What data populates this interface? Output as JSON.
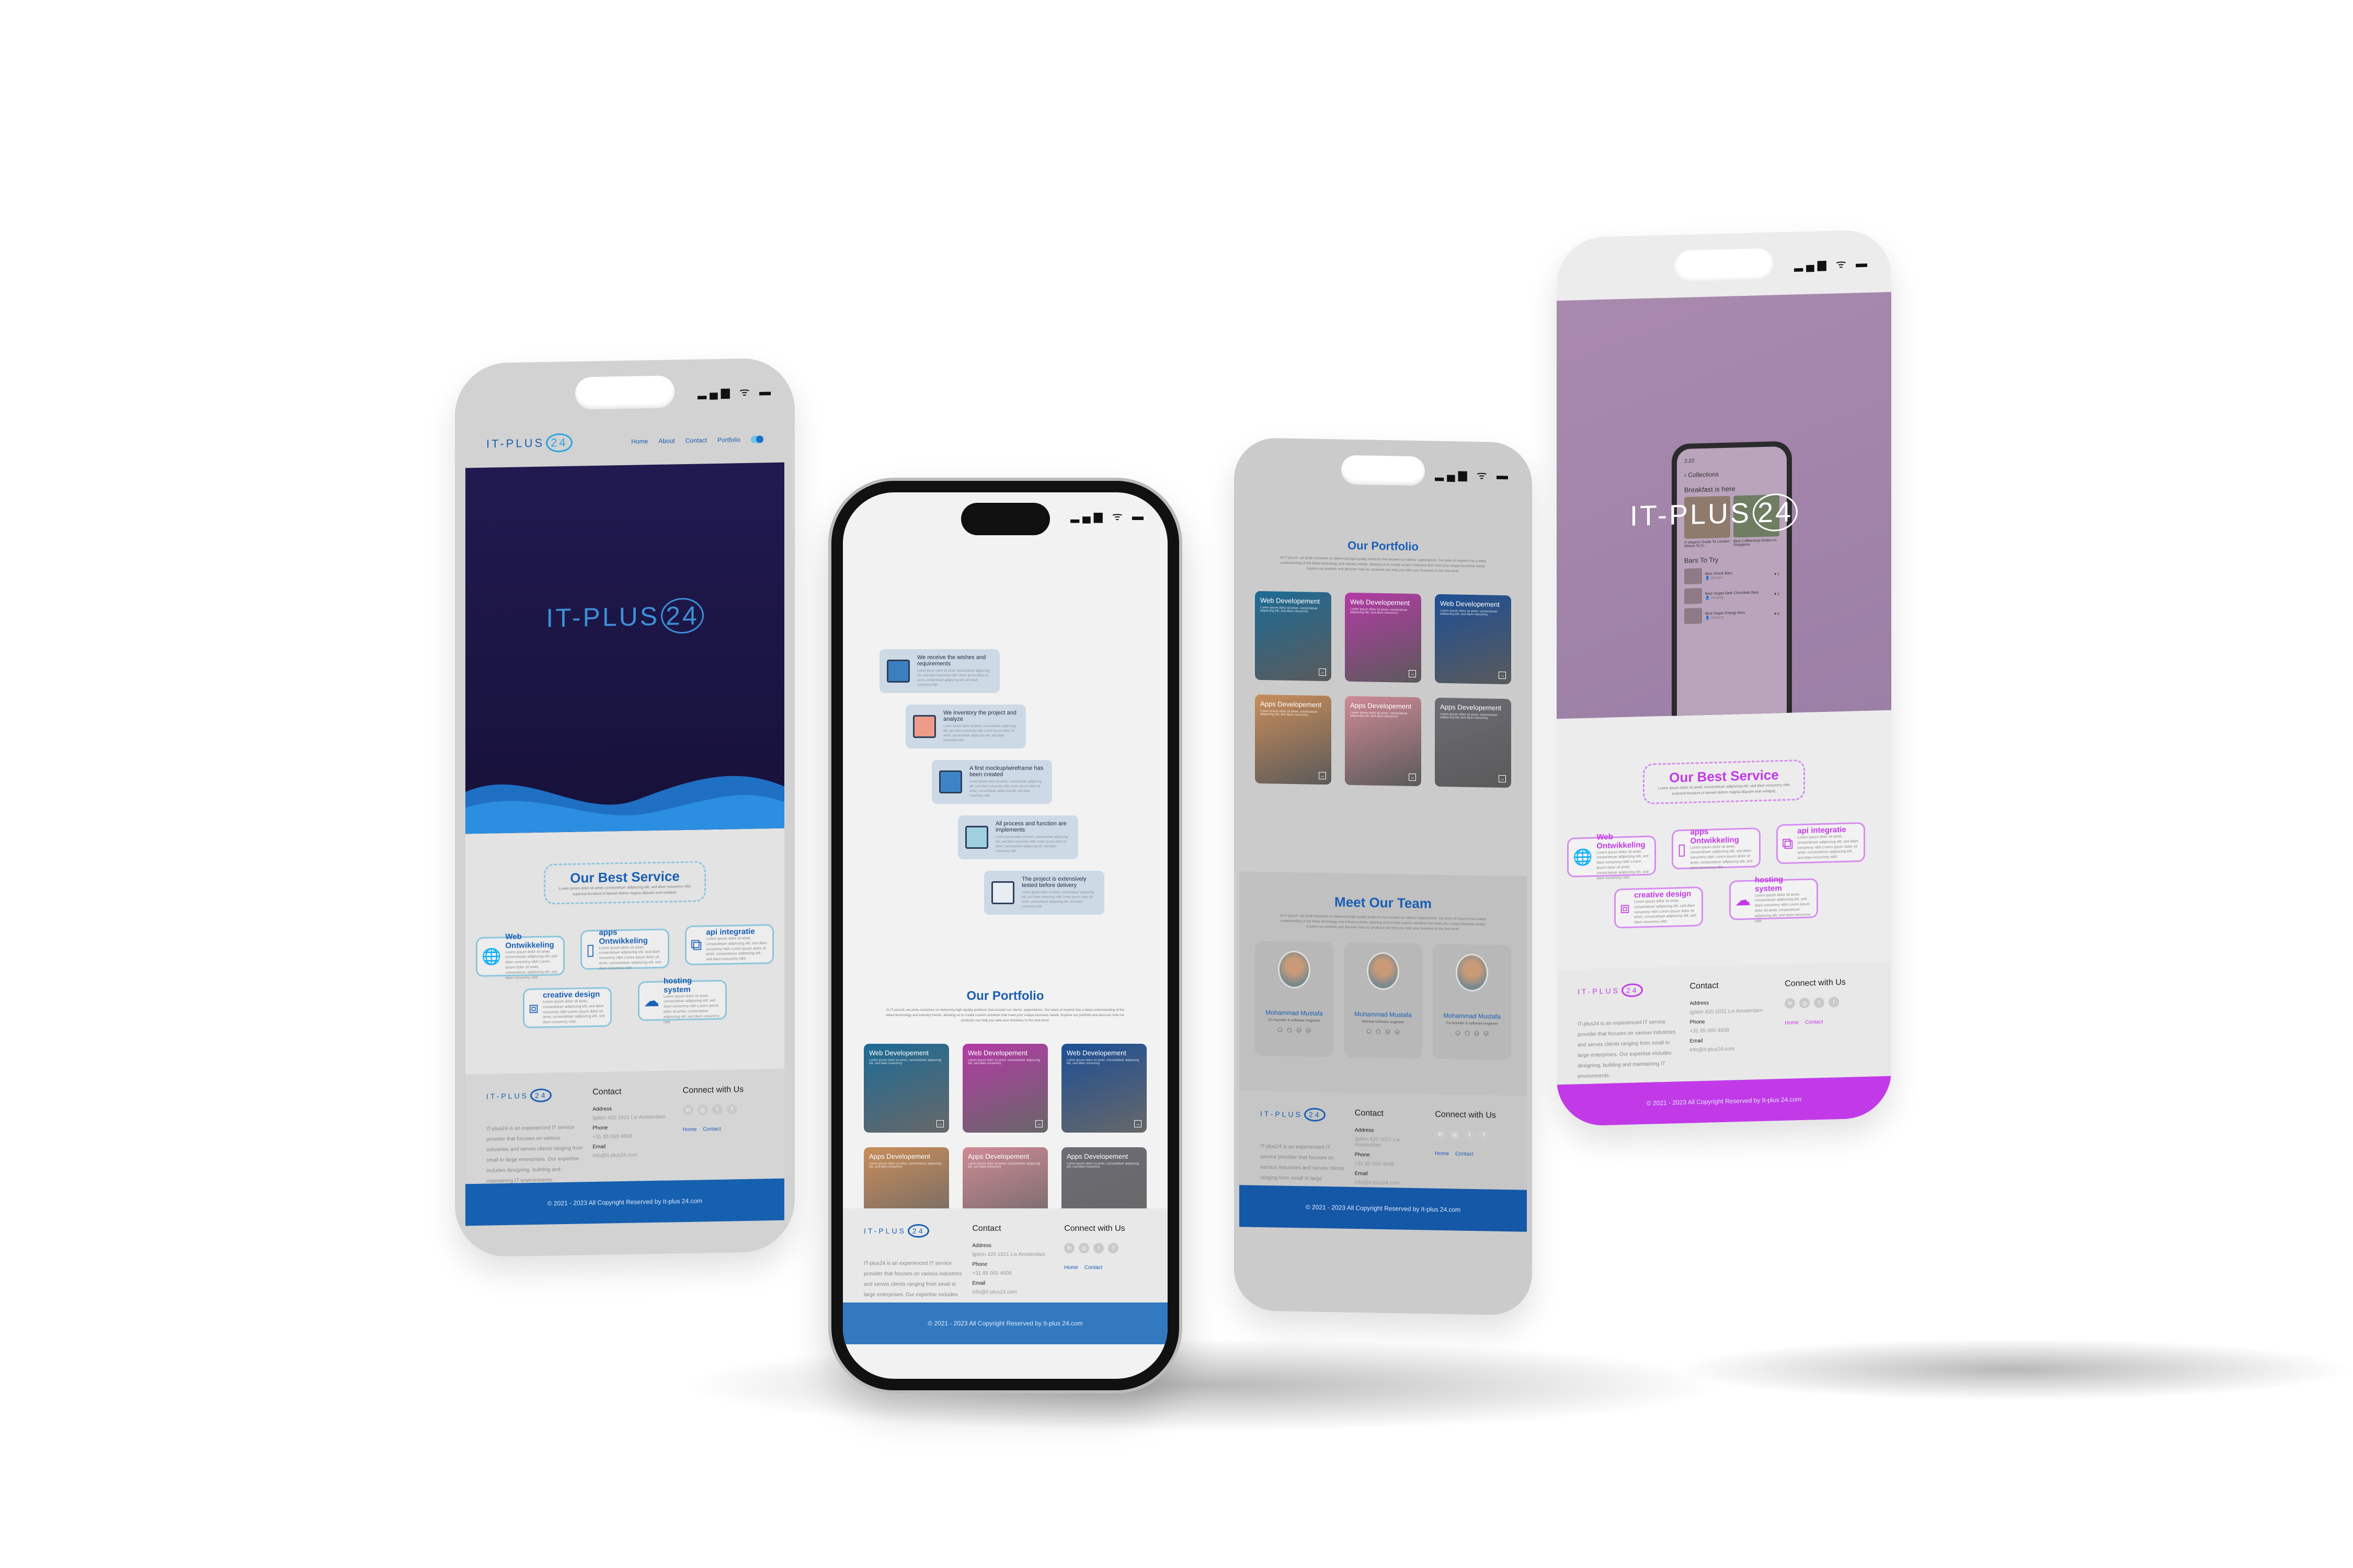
{
  "brand": {
    "logo_text": "IT-PLUS",
    "logo_number": "24"
  },
  "colors": {
    "blue": "#1a5fb4",
    "light_blue": "#2aa5de",
    "navy": "#1b1446",
    "purple": "#c23ae8"
  },
  "status_icons": "▂▄▆ ᯤ ▬",
  "nav": {
    "items": [
      "Home",
      "About",
      "Contact",
      "Portfolio"
    ]
  },
  "services": {
    "title": "Our Best Service",
    "description": "Lorem ipsum dolor sit amet, consectetuer adipiscing elit, sed diam nonummy nibh euismod tincidunt ut laoreet dolore magna aliquam erat volutpat.",
    "items": [
      {
        "title": "Web Ontwikkeling",
        "icon": "globe-icon",
        "glyph": "🌐",
        "desc": "Lorem ipsum dolor sit amet, consectetuer adipiscing elit, sed diam nonummy nibh Lorem ipsum dolor sit amet, consectetuer adipiscing elit, sed diam nonummy nibh"
      },
      {
        "title": "apps Ontwikkeling",
        "icon": "smartphone-icon",
        "glyph": "▯",
        "desc": "Lorem ipsum dolor sit amet, consectetuer adipiscing elit, sed diam nonummy nibh Lorem ipsum dolor sit amet, consectetuer adipiscing elit, sed diam nonummy nibh"
      },
      {
        "title": "api integratie",
        "icon": "hierarchy-icon",
        "glyph": "⧉",
        "desc": "Lorem ipsum dolor sit amet, consectetuer adipiscing elit, sed diam nonummy nibh Lorem ipsum dolor sit amet, consectetuer adipiscing elit, sed diam nonummy nibh"
      },
      {
        "title": "creative design",
        "icon": "design-icon",
        "glyph": "⧈",
        "desc": "Lorem ipsum dolor sit amet, consectetuer adipiscing elit, sed diam nonummy nibh Lorem ipsum dolor sit amet, consectetuer adipiscing elit, sed diam nonummy nibh"
      },
      {
        "title": "hosting system",
        "icon": "cloud-upload-icon",
        "glyph": "☁",
        "desc": "Lorem ipsum dolor sit amet, consectetuer adipiscing elit, sed diam nonummy nibh Lorem ipsum dolor sit amet, consectetuer adipiscing elit, sed diam nonummy nibh"
      }
    ]
  },
  "process": {
    "steps": [
      {
        "title": "We receive the wishes and requirements",
        "desc": "Lorem ipsum dolor sit amet, consectetuer adipiscing elit, sed diam nonummy nibh Lorem ipsum dolor sit amet, consectetuer adipiscing elit, sed diam nonummy nibh"
      },
      {
        "title": "We inventory the project and analyze",
        "desc": "Lorem ipsum dolor sit amet, consectetuer adipiscing elit, sed diam nonummy nibh Lorem ipsum dolor sit amet, consectetuer adipiscing elit, sed diam nonummy nibh"
      },
      {
        "title": "A first mockup/wireframe has been created",
        "desc": "Lorem ipsum dolor sit amet, consectetuer adipiscing elit, sed diam nonummy nibh Lorem ipsum dolor sit amet, consectetuer adipiscing elit, sed diam nonummy nibh"
      },
      {
        "title": "All process and function are implements",
        "desc": "Lorem ipsum dolor sit amet, consectetuer adipiscing elit, sed diam nonummy nibh Lorem ipsum dolor sit amet, consectetuer adipiscing elit, sed diam nonummy nibh"
      },
      {
        "title": "The project is extensively tested before delivery",
        "desc": "Lorem ipsum dolor sit amet, consectetuer adipiscing elit, sed diam nonummy nibh Lorem ipsum dolor sit amet, consectetuer adipiscing elit, sed diam nonummy nibh"
      }
    ]
  },
  "portfolio": {
    "title": "Our Portfolio",
    "description": "At IT-plus24, we pride ourselves on delivering high-quality products that exceed our clients' expectations. Our team of experts has a deep understanding of the latest technology and industry trends, allowing us to create custom solutions that meet your unique business needs. Explore our portfolio and discover how our products can help you take your business to the next level.",
    "cards": [
      {
        "title": "Web Developement",
        "sub": "Lorem ipsum dolor sit amet, consectetuer adipiscing elit, sed diam nonummy",
        "color": "#1d6b96"
      },
      {
        "title": "Web Developement",
        "sub": "Lorem ipsum dolor sit amet, consectetuer adipiscing elit, sed diam nonummy",
        "color": "#b43aa6"
      },
      {
        "title": "Web Developement",
        "sub": "Lorem ipsum dolor sit amet, consectetuer adipiscing elit, sed diam nonummy",
        "color": "#1c4f96"
      },
      {
        "title": "Apps Developement",
        "sub": "Lorem ipsum dolor sit amet, consectetuer adipiscing elit, sed diam nonummy",
        "color": "#c98d5a"
      },
      {
        "title": "Apps Developement",
        "sub": "Lorem ipsum dolor sit amet, consectetuer adipiscing elit, sed diam nonummy",
        "color": "#cf8a95"
      },
      {
        "title": "Apps Developement",
        "sub": "Lorem ipsum dolor sit amet, consectetuer adipiscing elit, sed diam nonummy",
        "color": "#6c6c74"
      }
    ]
  },
  "team": {
    "title": "Meet Our Team",
    "description": "At IT-plus24, we pride ourselves on delivering high-quality products that exceed our clients' expectations. Our team of experts has a deep understanding of the latest technology and industry trends, allowing us to create custom solutions that meet your unique business needs. Explore our portfolio and discover how our products can help you take your business to the next level.",
    "members": [
      {
        "name": "Mohammad Mustafa",
        "role": "Co-founder & software engineer"
      },
      {
        "name": "Mohammad Mustafa",
        "role": "Internal software engineer"
      },
      {
        "name": "Mohammad Mustafa",
        "role": "Co-founder & software engineer"
      }
    ]
  },
  "footer": {
    "description": "IT-plus24 is an experienced IT service provider that focuses on various industries and serves clients ranging from small to large enterprises. Our expertise includes designing, building and maintaining IT environments.",
    "contact_title": "Contact",
    "address_label": "Address",
    "address": "Ijplein 420 1021 Lw Amsterdam",
    "phone_label": "Phone",
    "phone": "+31 85 060 4608",
    "email_label": "Email",
    "email": "info@it-plus24.com",
    "connect_title": "Connect with Us",
    "social": [
      "in",
      "◎",
      "t",
      "f"
    ],
    "links": [
      "Home",
      "Contact"
    ],
    "copyright": "© 2021 - 2023 All Copyright Reserved by It-plus 24.com"
  },
  "hero_app": {
    "time": "2:22",
    "back": "Collections",
    "section1": "Breakfast is here",
    "cards": [
      "A Vegan's Guide To London: Where To G...",
      "Best Coffeeshop Orders In Singapore"
    ],
    "section2": "Bars To Try",
    "list": [
      {
        "title": "Best Snack Bars",
        "user": "dhwani",
        "likes": "1"
      },
      {
        "title": "Best Vegan Dark Chocolate Bars",
        "user": "miriamy",
        "likes": "1"
      },
      {
        "title": "Best Vegan Energy Bars",
        "user": "miriamy",
        "likes": "0"
      }
    ]
  }
}
